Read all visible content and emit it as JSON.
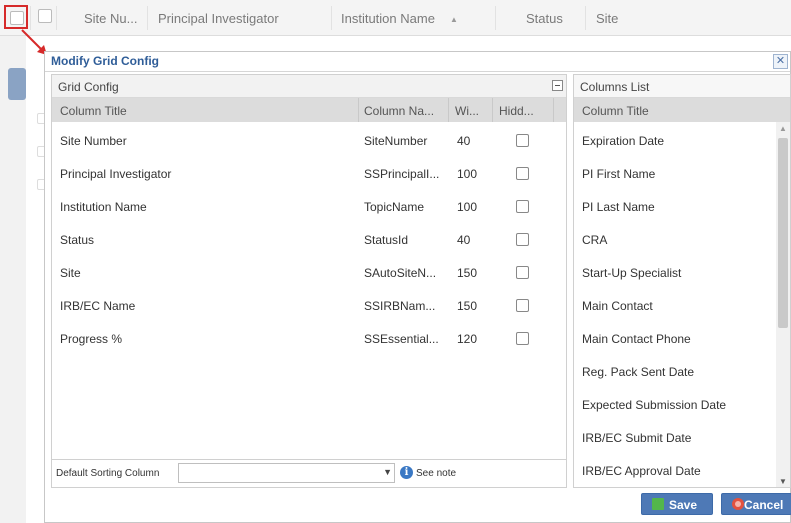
{
  "background_grid": {
    "columns": [
      "Site Nu...",
      "Principal Investigator",
      "Institution Name",
      "Status",
      "Site"
    ],
    "sort_indicator": "▲"
  },
  "dialog": {
    "title": "Modify Grid Config",
    "close_icon": "close-icon",
    "grid_config": {
      "header": "Grid Config",
      "columns": [
        "Column Title",
        "Column Na...",
        "Wi...",
        "Hidd..."
      ],
      "rows": [
        {
          "title": "Site Number",
          "column_name": "SiteNumber",
          "width": "40",
          "hidden": false
        },
        {
          "title": "Principal Investigator",
          "column_name": "SSPrincipalI...",
          "width": "100",
          "hidden": false
        },
        {
          "title": "Institution Name",
          "column_name": "TopicName",
          "width": "100",
          "hidden": false
        },
        {
          "title": "Status",
          "column_name": "StatusId",
          "width": "40",
          "hidden": false
        },
        {
          "title": "Site",
          "column_name": "SAutoSiteN...",
          "width": "150",
          "hidden": false
        },
        {
          "title": "IRB/EC Name",
          "column_name": "SSIRBNam...",
          "width": "150",
          "hidden": false
        },
        {
          "title": "Progress %",
          "column_name": "SSEssential...",
          "width": "120",
          "hidden": false
        }
      ],
      "footer": {
        "default_sorting_label": "Default Sorting Column",
        "default_sorting_value": "",
        "see_note": "See note"
      }
    },
    "columns_list": {
      "header": "Columns List",
      "column_header": "Column Title",
      "items": [
        "Expiration Date",
        "PI First Name",
        "PI Last Name",
        "CRA",
        "Start-Up Specialist",
        "Main Contact",
        "Main Contact Phone",
        "Reg. Pack Sent Date",
        "Expected Submission Date",
        "IRB/EC Submit Date",
        "IRB/EC Approval Date"
      ]
    },
    "buttons": {
      "save": "Save",
      "cancel": "Cancel"
    }
  },
  "colors": {
    "title_blue": "#2f5d98",
    "button_blue": "#4e79b6",
    "highlight_red": "#d62a2a"
  }
}
